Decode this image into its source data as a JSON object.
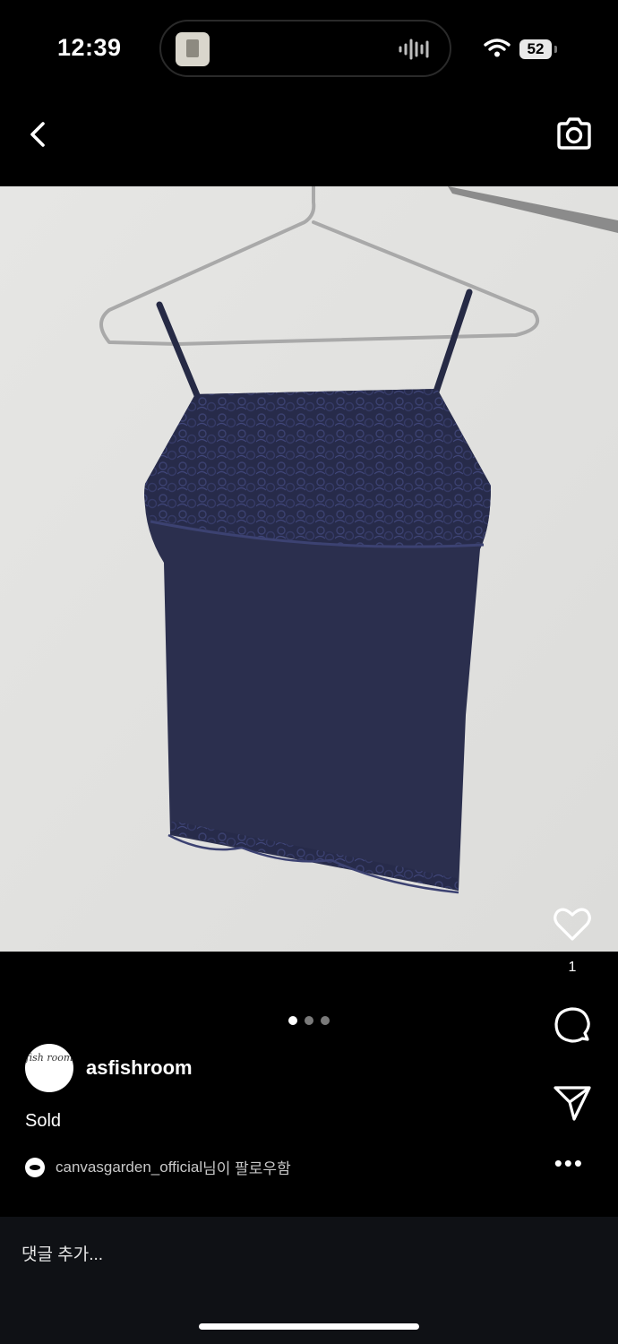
{
  "status_bar": {
    "time": "12:39",
    "battery": "52"
  },
  "nav": {
    "back_icon": "chevron-left-icon",
    "camera_icon": "camera-icon"
  },
  "post": {
    "like_count": "1",
    "carousel": {
      "count": 3,
      "active_index": 0
    },
    "author": {
      "username": "asfishroom",
      "avatar_text": "fish room"
    },
    "caption": "Sold",
    "follow_note": {
      "username": "canvasgarden_official",
      "suffix": "님이 팔로우함"
    }
  },
  "comment": {
    "placeholder": "댓글 추가..."
  },
  "colors": {
    "background": "#000000",
    "photo_wall": "#e4e4e2",
    "garment": "#2b2f4e"
  }
}
